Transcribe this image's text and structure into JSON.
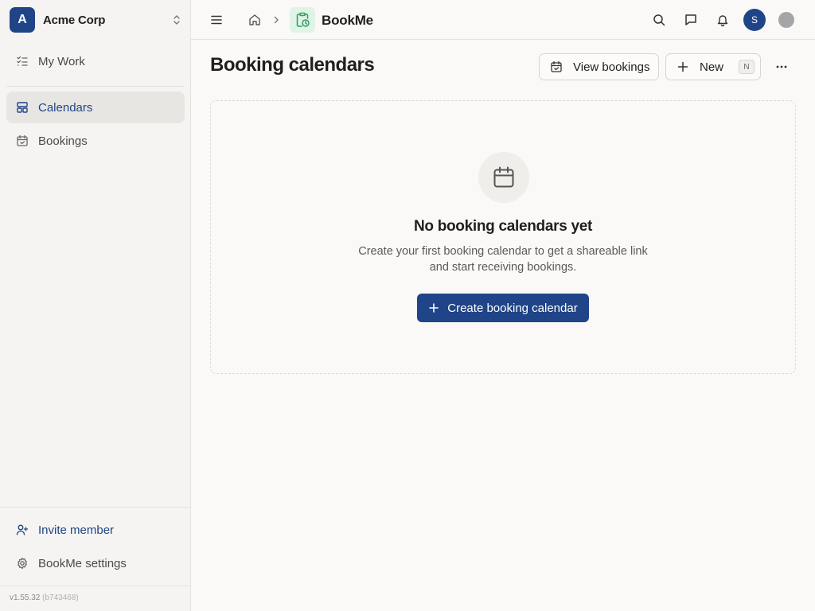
{
  "org": {
    "initial": "A",
    "name": "Acme Corp"
  },
  "sidebar": {
    "items": [
      {
        "label": "My Work",
        "icon": "checklist-icon"
      },
      {
        "label": "Calendars",
        "icon": "layout-icon",
        "active": true
      },
      {
        "label": "Bookings",
        "icon": "calendar-check-icon"
      }
    ],
    "bottom": [
      {
        "label": "Invite member",
        "icon": "user-plus-icon"
      },
      {
        "label": "BookMe settings",
        "icon": "gear-icon"
      }
    ],
    "version": "v1.55.32",
    "build": "(b743468)"
  },
  "topbar": {
    "app_name": "BookMe",
    "user_initial": "S"
  },
  "main": {
    "title": "Booking calendars",
    "view_bookings_label": "View bookings",
    "new_label": "New",
    "new_shortcut": "N",
    "empty": {
      "title": "No booking calendars yet",
      "line1": "Create your first booking calendar to get a shareable link",
      "line2": "and start receiving bookings.",
      "cta": "Create booking calendar"
    }
  },
  "colors": {
    "accent": "#1f4487",
    "app_badge_bg": "#dff3e7",
    "app_badge_fg": "#2e9e5e"
  }
}
